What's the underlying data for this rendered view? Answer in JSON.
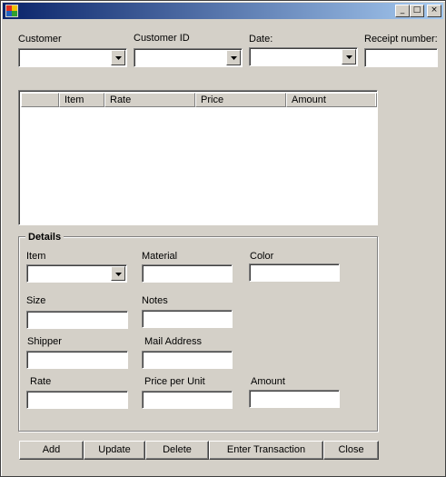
{
  "titlebar": {
    "title": "",
    "min": "_",
    "max": "□",
    "close": "×"
  },
  "top": {
    "customer_label": "Customer",
    "customer_id_label": "Customer ID",
    "date_label": "Date:",
    "receipt_label": "Receipt number:"
  },
  "grid": {
    "columns": [
      "",
      "Item",
      "Rate",
      "Price",
      "Amount"
    ]
  },
  "details": {
    "title": "Details",
    "item_label": "Item",
    "material_label": "Material",
    "color_label": "Color",
    "size_label": "Size",
    "notes_label": "Notes",
    "shipper_label": "Shipper",
    "mail_label": "Mail Address",
    "rate_label": "Rate",
    "ppu_label": "Price per Unit",
    "amount_label": "Amount"
  },
  "buttons": {
    "add": "Add",
    "update": "Update",
    "delete": "Delete",
    "enter": "Enter Transaction",
    "close": "Close"
  }
}
